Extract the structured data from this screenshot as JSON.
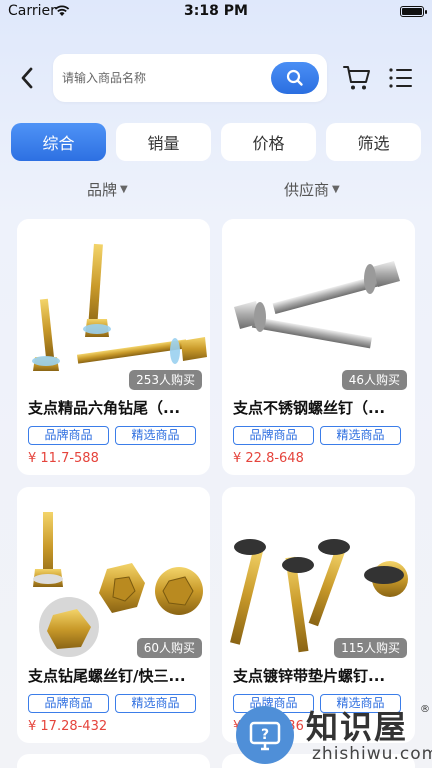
{
  "status_bar": {
    "carrier": "Carrier",
    "time": "3:18 PM"
  },
  "search": {
    "placeholder": "请输入商品名称"
  },
  "sort_tabs": [
    {
      "label": "综合",
      "active": true
    },
    {
      "label": "销量",
      "active": false
    },
    {
      "label": "价格",
      "active": false
    },
    {
      "label": "筛选",
      "active": false
    }
  ],
  "filters": [
    {
      "label": "品牌"
    },
    {
      "label": "供应商"
    }
  ],
  "products": [
    {
      "title": "支点精品六角钻尾（...",
      "sales": "253人购买",
      "tags": [
        "品牌商品",
        "精选商品"
      ],
      "price": "¥ 11.7-588"
    },
    {
      "title": "支点不锈钢螺丝钉（...",
      "sales": "46人购买",
      "tags": [
        "品牌商品",
        "精选商品"
      ],
      "price": "¥ 22.8-648"
    },
    {
      "title": "支点钻尾螺丝钉/快三...",
      "sales": "60人购买",
      "tags": [
        "品牌商品",
        "精选商品"
      ],
      "price": "¥ 17.28-432"
    },
    {
      "title": "支点镀锌带垫片螺钉...",
      "sales": "115人购买",
      "tags": [
        "品牌商品",
        "精选商品"
      ],
      "price": "¥ 12.5-636"
    }
  ],
  "watermark": {
    "title": "知识屋",
    "reg": "®",
    "url": "zhishiwu.com"
  },
  "colors": {
    "accent": "#2d70e2",
    "price": "#e5443c",
    "tag_border": "#3b7de9"
  },
  "icons": [
    "wifi-icon",
    "battery-icon",
    "back-icon",
    "search-icon",
    "cart-icon",
    "menu-icon",
    "caret-down-icon"
  ]
}
